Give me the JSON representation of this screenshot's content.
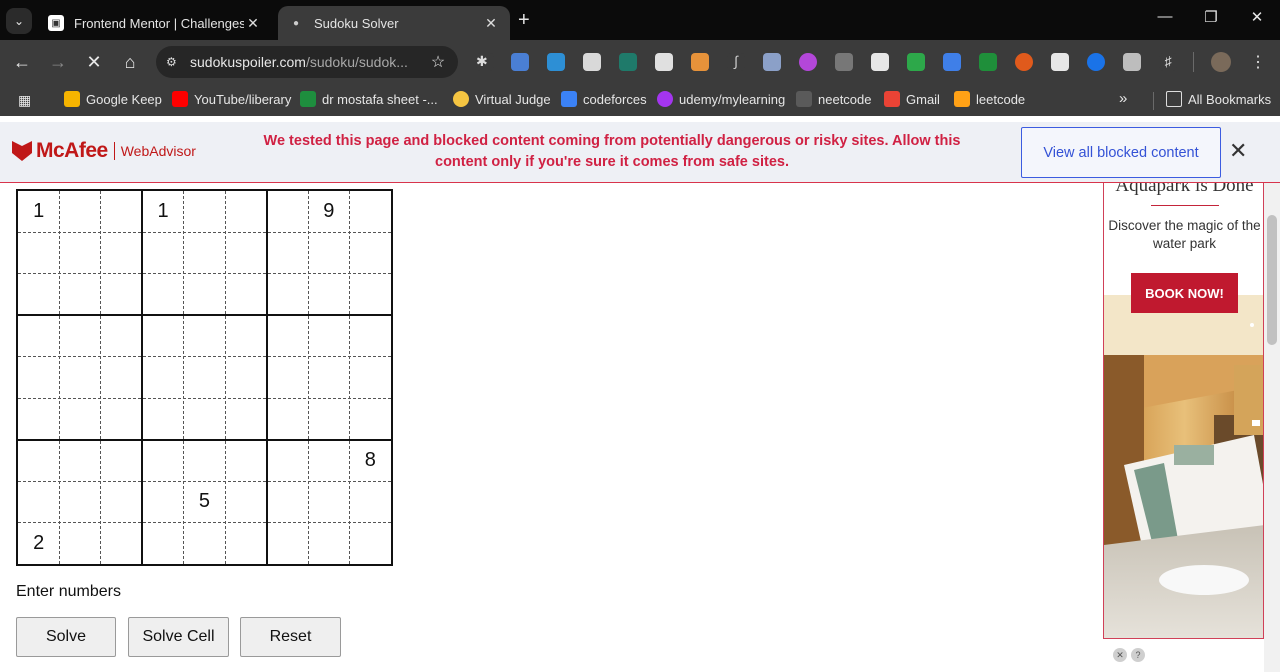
{
  "browser": {
    "tabs": [
      {
        "title": "Frontend Mentor | Challenges",
        "active": false,
        "favicon": "frontend-mentor-icon"
      },
      {
        "title": "Sudoku Solver",
        "active": true,
        "favicon": "globe-icon"
      }
    ],
    "url_host": "sudokuspoiler.com",
    "url_path": "/sudoku/sudok...",
    "bookmarks": [
      {
        "label": "Google Keep",
        "color": "#f6b400"
      },
      {
        "label": "YouTube/liberary",
        "color": "#ff0000"
      },
      {
        "label": "dr mostafa sheet -...",
        "color": "#1e8e3e"
      },
      {
        "label": "Virtual Judge",
        "color": "#f5c542"
      },
      {
        "label": "codeforces",
        "color": "#3b82f6"
      },
      {
        "label": "udemy/mylearning",
        "color": "#a435f0"
      },
      {
        "label": "neetcode",
        "color": "#e8e8e8"
      },
      {
        "label": "Gmail",
        "color": "#ea4335"
      },
      {
        "label": "leetcode",
        "color": "#ffa116"
      }
    ],
    "all_bookmarks": "All Bookmarks"
  },
  "mcafee": {
    "brand": "McAfee",
    "product": "WebAdvisor",
    "message": "We tested this page and blocked content coming from potentially dangerous or risky sites. Allow this content only if you're sure it comes from safe sites.",
    "button": "View all blocked content"
  },
  "sudoku": {
    "grid": [
      [
        "1",
        "",
        "",
        "1",
        "",
        "",
        "",
        "9",
        ""
      ],
      [
        "",
        "",
        "",
        "",
        "",
        "",
        "",
        "",
        ""
      ],
      [
        "",
        "",
        "",
        "",
        "",
        "",
        "",
        "",
        ""
      ],
      [
        "",
        "",
        "",
        "",
        "",
        "",
        "",
        "",
        ""
      ],
      [
        "",
        "",
        "",
        "",
        "",
        "",
        "",
        "",
        ""
      ],
      [
        "",
        "",
        "",
        "",
        "",
        "",
        "",
        "",
        ""
      ],
      [
        "",
        "",
        "",
        "",
        "",
        "",
        "",
        "",
        "8"
      ],
      [
        "",
        "",
        "",
        "",
        "5",
        "",
        "",
        "",
        ""
      ],
      [
        "2",
        "",
        "",
        "",
        "",
        "",
        "",
        "",
        ""
      ]
    ],
    "instruction": "Enter numbers",
    "buttons": {
      "solve": "Solve",
      "solve_cell": "Solve Cell",
      "reset": "Reset"
    }
  },
  "ad": {
    "headline": "Aquapark is Done",
    "subtext": "Discover the magic of the water park",
    "cta": "BOOK NOW!"
  },
  "colors": {
    "mcafee_red": "#c01818",
    "alert_text": "#d02143",
    "link_blue": "#3452d6",
    "ad_red": "#c0192f"
  }
}
